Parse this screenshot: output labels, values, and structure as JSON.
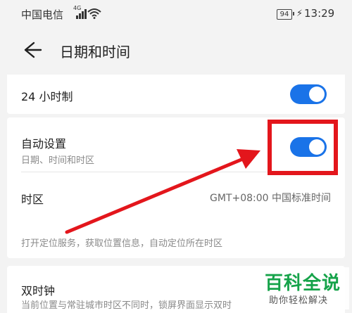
{
  "status_bar": {
    "carrier": "中国电信",
    "network_type": "4G",
    "battery": "94",
    "time": "13:29"
  },
  "header": {
    "back_icon": "arrow-left-icon",
    "title": "日期和时间"
  },
  "settings": {
    "hour24": {
      "label": "24 小时制",
      "enabled": true
    },
    "auto_set": {
      "label": "自动设置",
      "subtitle": "日期、时间和时区",
      "enabled": true
    },
    "timezone": {
      "label": "时区",
      "value": "GMT+08:00 中国标准时间"
    },
    "location_hint": "打开定位服务，获取位置信息，自动定位所在时区",
    "dual_clock": {
      "label": "双时钟",
      "subtitle": "当前位置与常驻城市时区不同时，锁屏界面显示双时"
    }
  },
  "watermark": {
    "title": "百科全说",
    "subtitle": "助你轻松解决"
  },
  "colors": {
    "toggle_on": "#1a73e8",
    "highlight": "#e3161c",
    "arrow": "#e3161c",
    "watermark_green": "#16a34a"
  }
}
